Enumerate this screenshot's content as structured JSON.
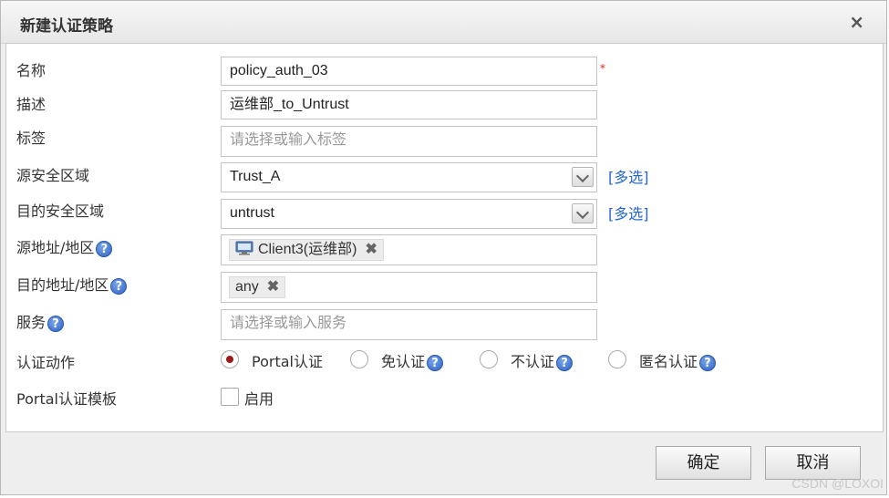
{
  "dialog": {
    "title": "新建认证策略",
    "close_icon": "×"
  },
  "form": {
    "name_label": "名称",
    "name_value": "policy_auth_03",
    "required_mark": "*",
    "desc_label": "描述",
    "desc_value": "运维部_to_Untrust",
    "tag_label": "标签",
    "tag_placeholder": "请选择或输入标签",
    "src_zone_label": "源安全区域",
    "src_zone_value": "Trust_A",
    "dst_zone_label": "目的安全区域",
    "dst_zone_value": "untrust",
    "multi_select": "[多选]",
    "src_addr_label": "源地址/地区",
    "src_addr_tag": "Client3(运维部)",
    "dst_addr_label": "目的地址/地区",
    "dst_addr_tag": "any",
    "service_label": "服务",
    "service_placeholder": "请选择或输入服务",
    "auth_action_label": "认证动作",
    "auth_options": [
      {
        "label": "Portal认证",
        "checked": true,
        "help": false
      },
      {
        "label": "免认证",
        "checked": false,
        "help": true
      },
      {
        "label": "不认证",
        "checked": false,
        "help": true
      },
      {
        "label": "匿名认证",
        "checked": false,
        "help": true
      }
    ],
    "portal_template_label": "Portal认证模板",
    "enable_label": "启用",
    "enable_checked": false,
    "help_glyph": "?",
    "remove_glyph": "✖"
  },
  "buttons": {
    "ok": "确定",
    "cancel": "取消"
  },
  "watermark": "CSDN @LOXOI",
  "colors": {
    "link": "#2266cc",
    "radio_dot": "#9b1a1a",
    "required": "#dd2222",
    "help_icon": "#2d63c8"
  },
  "icons": {
    "close": "close-icon",
    "dropdown": "chevron-down-icon",
    "help": "help-icon",
    "remove": "remove-icon",
    "computer": "computer-icon"
  }
}
